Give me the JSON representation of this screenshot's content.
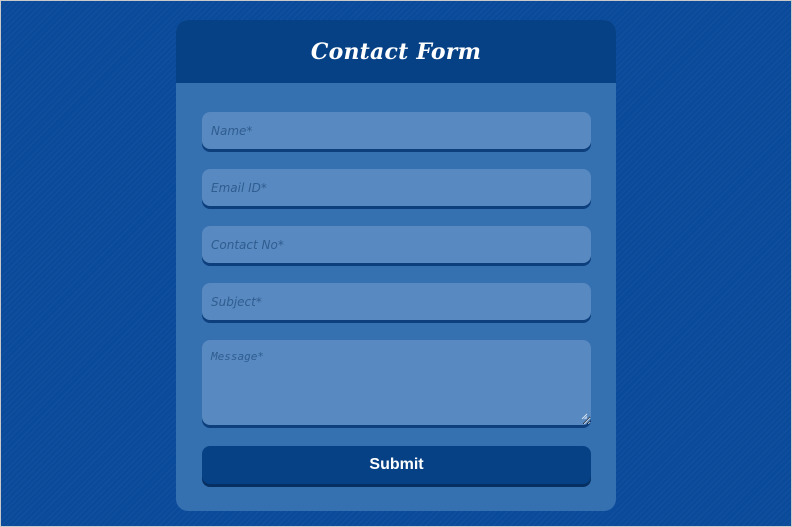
{
  "form": {
    "title": "Contact Form",
    "fields": [
      {
        "placeholder": "Name*"
      },
      {
        "placeholder": "Email ID*"
      },
      {
        "placeholder": "Contact No*"
      },
      {
        "placeholder": "Subject*"
      }
    ],
    "message": {
      "placeholder": "Message*"
    },
    "submit_label": "Submit"
  },
  "colors": {
    "background": "#0a4a9a",
    "card": "#3570b1",
    "header": "#064185",
    "field": "#5889c0",
    "button": "#064185",
    "text_light": "#ffffff"
  }
}
